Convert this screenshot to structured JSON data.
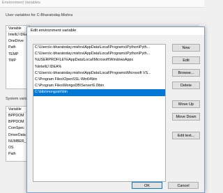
{
  "background": {
    "title": "Environment Variables",
    "user_group_label": "User variables for C-Bharatoday.Mishra",
    "system_group_label": "System varia",
    "user_list_header": "Variable",
    "user_rows": [
      "IntelliJ IDEA",
      "OneDrive",
      "Path",
      "TEMP",
      "TMP"
    ],
    "system_list_header": "Variable",
    "system_rows": [
      "BPPDOM",
      "BPPDOM",
      "ComSpec",
      "DriverData",
      "NUMBER_",
      "OS",
      "Path"
    ]
  },
  "dialog": {
    "title": "Edit environment variable",
    "entries": [
      "C:\\Users\\c-bharatoday.mishra\\AppData\\Local\\Programs\\Python\\Pyth...",
      "C:\\Users\\c-bharatoday.mishra\\AppData\\Local\\Programs\\Python\\Pyth...",
      "%USERPROFILE%\\AppData\\Local\\Microsoft\\WindowsApps",
      "%IntelliJ IDEA%",
      "C:\\Users\\c-bharatoday.mishra\\AppData\\Local\\Programs\\Microsoft VS...",
      "C:\\Program Files\\OpenSSL-Win64\\bin",
      "C:\\Program Files\\MongoDB\\Server\\6.0\\bin",
      "C:\\bits\\mongosh\\bin"
    ],
    "selected_index": 7,
    "buttons": {
      "new": "New",
      "edit": "Edit",
      "browse": "Browse...",
      "delete": "Delete",
      "move_up": "Move Up",
      "move_down": "Move Down",
      "edit_text": "Edit text...",
      "ok": "OK",
      "cancel": "Cancel"
    }
  }
}
